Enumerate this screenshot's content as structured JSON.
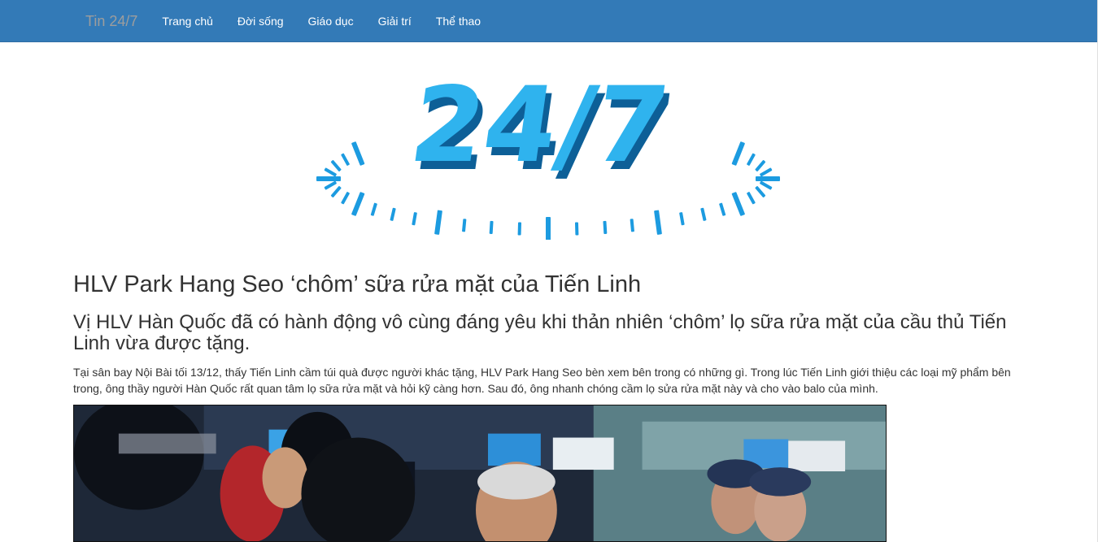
{
  "navbar": {
    "brand": "Tin 24/7",
    "items": [
      {
        "label": "Trang chủ"
      },
      {
        "label": "Đời sống"
      },
      {
        "label": "Giáo dục"
      },
      {
        "label": "Giải trí"
      },
      {
        "label": "Thể thao"
      }
    ],
    "bg_color": "#337ab7"
  },
  "logo": {
    "text": "24/7",
    "color": "#1da1e2"
  },
  "article": {
    "title": "HLV Park Hang Seo ‘chôm’ sữa rửa mặt của Tiến Linh",
    "summary": "Vị HLV Hàn Quốc đã có hành động vô cùng đáng yêu khi thản nhiên ‘chôm’ lọ sữa rửa mặt của cầu thủ Tiến Linh vừa được tặng.",
    "body": "Tại sân bay Nội Bài tối 13/12, thấy Tiến Linh cầm túi quà được người khác tặng, HLV Park Hang Seo bèn xem bên trong có những gì. Trong lúc Tiến Linh giới thiệu các loại mỹ phẩm bên trong, ông thầy người Hàn Quốc rất quan tâm lọ sữa rửa mặt và hỏi kỹ càng hơn. Sau đó, ông nhanh chóng cầm lọ sửa rửa mặt này và cho vào balo của mình."
  }
}
